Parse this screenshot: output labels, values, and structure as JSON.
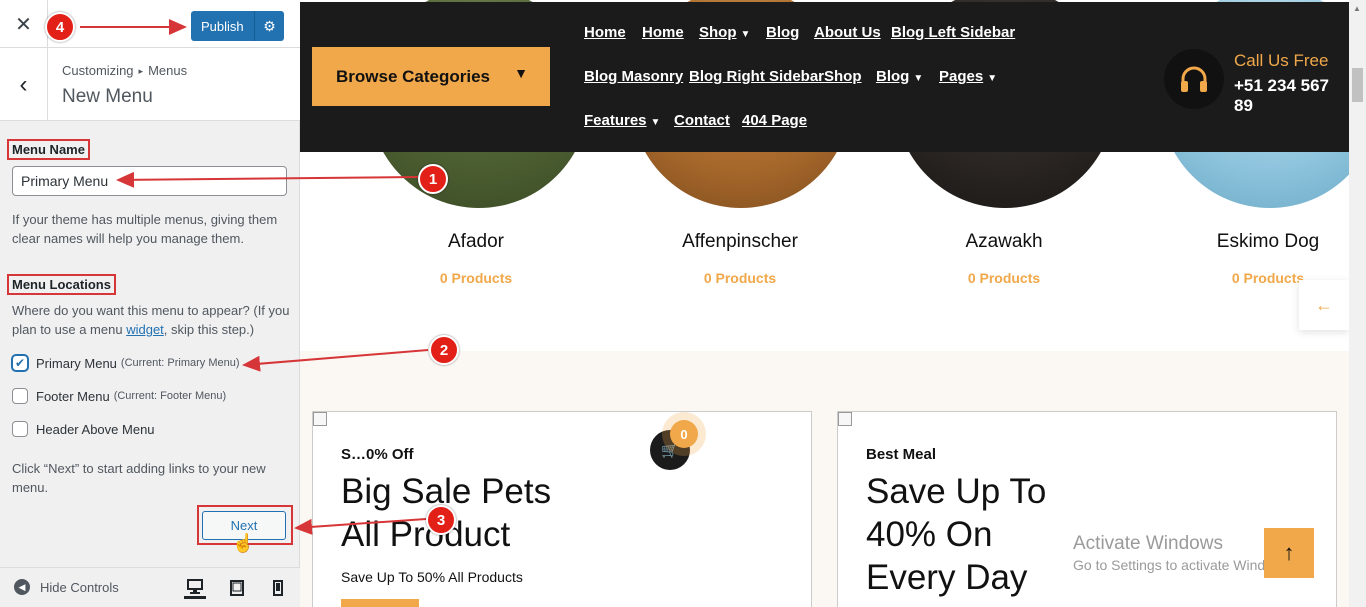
{
  "customizer": {
    "close_icon": "✕",
    "publish_label": "Publish",
    "breadcrumb_root": "Customizing",
    "breadcrumb_sep": "▸",
    "breadcrumb_current": "Menus",
    "section_title": "New Menu",
    "menu_name_label": "Menu Name",
    "menu_name_value": "Primary Menu",
    "menu_name_help": "If your theme has multiple menus, giving them clear names will help you manage them.",
    "menu_locations_label": "Menu Locations",
    "locations_help_before": "Where do you want this menu to appear? (If you plan to use a menu ",
    "locations_help_link": "widget",
    "locations_help_after": ", skip this step.)",
    "locations": [
      {
        "label": "Primary Menu",
        "current": "(Current: Primary Menu)",
        "checked": true
      },
      {
        "label": "Footer Menu",
        "current": "(Current: Footer Menu)",
        "checked": false
      },
      {
        "label": "Header Above Menu",
        "current": "",
        "checked": false
      }
    ],
    "next_help": "Click “Next” to start adding links to your new menu.",
    "next_label": "Next",
    "hide_controls_label": "Hide Controls"
  },
  "annotations": [
    "1",
    "2",
    "3",
    "4"
  ],
  "site": {
    "browse_label": "Browse Categories",
    "nav": [
      {
        "label": "Home"
      },
      {
        "label": "Home"
      },
      {
        "label": "Shop",
        "dropdown": true
      },
      {
        "label": "Blog"
      },
      {
        "label": "About Us"
      },
      {
        "label": "Blog Left Sidebar"
      },
      {
        "label": "Blog Masonry"
      },
      {
        "label": "Blog Right Sidebar"
      },
      {
        "label": "Shop"
      },
      {
        "label": "Blog",
        "dropdown": true
      },
      {
        "label": "Pages",
        "dropdown": true
      },
      {
        "label": "Features",
        "dropdown": true
      },
      {
        "label": "Contact"
      },
      {
        "label": "404 Page"
      }
    ],
    "call_label": "Call Us Free",
    "call_number": "+51 234 567 89",
    "categories": [
      {
        "name": "Afador",
        "count": "0 Products"
      },
      {
        "name": "Affenpinscher",
        "count": "0 Products"
      },
      {
        "name": "Azawakh",
        "count": "0 Products"
      },
      {
        "name": "Eskimo Dog",
        "count": "0 Products"
      }
    ],
    "promo1": {
      "kicker": "S…0% Off",
      "title_line1": "Big Sale Pets",
      "title_line2": "All Product",
      "sub": "Save Up To 50% All Products"
    },
    "promo2": {
      "kicker": "Best Meal",
      "title_line1": "Save Up To",
      "title_line2": "40% On",
      "title_line3": "Every Day"
    },
    "cart_count": "0",
    "activate_line1": "Activate Windows",
    "activate_line2": "Go to Settings to activate Windows."
  },
  "colors": {
    "accent": "#f0a84a",
    "wp_blue": "#2271b1",
    "annotation_red": "#e32018",
    "header_dark": "#1b1b1b"
  },
  "icons": [
    "close-icon",
    "gear-icon",
    "back-icon",
    "checkbox-icon",
    "desktop-icon",
    "tablet-icon",
    "mobile-icon",
    "headphones-icon",
    "chevron-down-icon",
    "arrow-left-icon",
    "arrow-up-icon",
    "cart-icon",
    "hand-cursor-icon"
  ]
}
